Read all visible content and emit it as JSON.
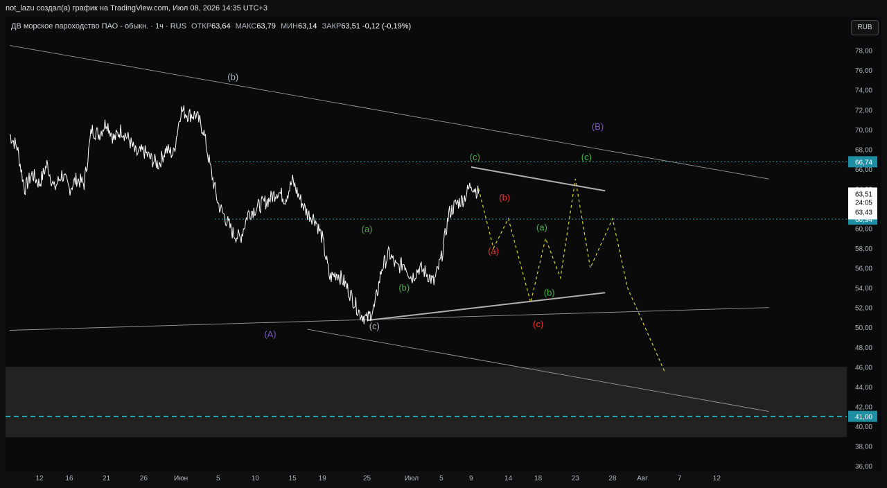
{
  "header": {
    "attribution": "not_lazu создал(а) график на TradingView.com, Июл 08, 2026 14:35 UTC+3"
  },
  "legend": {
    "symbol": "ДВ морское пароходство ПАО - обыкн.",
    "interval": "1ч",
    "exchange": "RUS",
    "open_label": "ОТКР",
    "open": "63,64",
    "high_label": "МАКС",
    "high": "63,79",
    "low_label": "МИН",
    "low": "63,14",
    "close_label": "ЗАКР",
    "close": "63,51",
    "change": "-0,12 (-0,19%)"
  },
  "currency_button": "RUB",
  "colors": {
    "background": "#0a0a0a",
    "price": "#ffffff",
    "trend": "#9a9a9a",
    "forecast": "#d4d43a",
    "level_cyan": "#26c6da",
    "wave_green": "#4caf50",
    "wave_red": "#e53935",
    "wave_purple": "#7e57c2",
    "wave_gray": "#b2b5be"
  },
  "chart_data": {
    "type": "line",
    "title": "",
    "xlabel": "",
    "ylabel": "",
    "ylim": [
      36,
      80
    ],
    "y_ticks": [
      "78,00",
      "76,00",
      "74,00",
      "72,00",
      "70,00",
      "68,00",
      "66,00",
      "64,00",
      "62,00",
      "60,00",
      "58,00",
      "56,00",
      "54,00",
      "52,00",
      "50,00",
      "48,00",
      "46,00",
      "44,00",
      "42,00",
      "40,00",
      "38,00",
      "36,00"
    ],
    "x_ticks": [
      {
        "label": "12",
        "day": 12
      },
      {
        "label": "16",
        "day": 16
      },
      {
        "label": "21",
        "day": 21
      },
      {
        "label": "26",
        "day": 26
      },
      {
        "label": "Июн",
        "day": 31
      },
      {
        "label": "5",
        "day": 36
      },
      {
        "label": "10",
        "day": 41
      },
      {
        "label": "15",
        "day": 46
      },
      {
        "label": "19",
        "day": 50
      },
      {
        "label": "25",
        "day": 56
      },
      {
        "label": "Июл",
        "day": 62
      },
      {
        "label": "5",
        "day": 66
      },
      {
        "label": "9",
        "day": 70
      },
      {
        "label": "14",
        "day": 75
      },
      {
        "label": "18",
        "day": 79
      },
      {
        "label": "23",
        "day": 84
      },
      {
        "label": "28",
        "day": 89
      },
      {
        "label": "Авг",
        "day": 93
      },
      {
        "label": "7",
        "day": 98
      },
      {
        "label": "12",
        "day": 103
      }
    ],
    "price_series": {
      "name": "",
      "points": [
        [
          8,
          69.5
        ],
        [
          9,
          68.2
        ],
        [
          10,
          64.0
        ],
        [
          11,
          65.5
        ],
        [
          12,
          64.5
        ],
        [
          13,
          66.5
        ],
        [
          14,
          64.0
        ],
        [
          15,
          65.5
        ],
        [
          16,
          64.0
        ],
        [
          17,
          65.0
        ],
        [
          18,
          64.5
        ],
        [
          19,
          70.0
        ],
        [
          20,
          69.5
        ],
        [
          21,
          70.8
        ],
        [
          22,
          69.0
        ],
        [
          23,
          70.0
        ],
        [
          24,
          69.0
        ],
        [
          25,
          67.5
        ],
        [
          26,
          67.8
        ],
        [
          27,
          67.0
        ],
        [
          28,
          66.5
        ],
        [
          29,
          68.0
        ],
        [
          30,
          67.5
        ],
        [
          31,
          72.0
        ],
        [
          32,
          71.5
        ],
        [
          33,
          71.5
        ],
        [
          34,
          70.0
        ],
        [
          35,
          66.0
        ],
        [
          36,
          62.5
        ],
        [
          37,
          61.0
        ],
        [
          38,
          59.5
        ],
        [
          39,
          59.0
        ],
        [
          40,
          61.5
        ],
        [
          41,
          62.0
        ],
        [
          42,
          62.5
        ],
        [
          43,
          63.0
        ],
        [
          44,
          63.8
        ],
        [
          45,
          63.0
        ],
        [
          46,
          64.8
        ],
        [
          47,
          63.0
        ],
        [
          48,
          61.5
        ],
        [
          49,
          61.0
        ],
        [
          50,
          59.0
        ],
        [
          51,
          55.0
        ],
        [
          52,
          55.5
        ],
        [
          53,
          54.5
        ],
        [
          54,
          53.0
        ],
        [
          55,
          51.5
        ],
        [
          56,
          50.8
        ],
        [
          57,
          52.0
        ],
        [
          58,
          56.0
        ],
        [
          59,
          57.5
        ],
        [
          60,
          56.0
        ],
        [
          61,
          56.5
        ],
        [
          62,
          55.0
        ],
        [
          63,
          56.0
        ],
        [
          64,
          55.5
        ],
        [
          65,
          54.5
        ],
        [
          66,
          57.0
        ],
        [
          67,
          61.5
        ],
        [
          68,
          62.5
        ],
        [
          69,
          63.0
        ],
        [
          70,
          64.5
        ],
        [
          71,
          63.51
        ]
      ]
    },
    "forecast_path": {
      "name": "",
      "points": [
        [
          71,
          64.0
        ],
        [
          73,
          58.0
        ],
        [
          75,
          61.0
        ],
        [
          78,
          52.5
        ],
        [
          80,
          59.0
        ],
        [
          82,
          55.0
        ],
        [
          84,
          65.0
        ],
        [
          86,
          56.0
        ],
        [
          89,
          61.0
        ],
        [
          91,
          54.0
        ],
        [
          96,
          45.5
        ]
      ]
    },
    "trendlines": [
      {
        "from": [
          8,
          78.5
        ],
        "to": [
          110,
          65.0
        ],
        "weight": 1
      },
      {
        "from": [
          8,
          49.7
        ],
        "to": [
          110,
          52.0
        ],
        "weight": 1
      },
      {
        "from": [
          48,
          49.8
        ],
        "to": [
          110,
          41.5
        ],
        "weight": 1
      },
      {
        "from": [
          70,
          66.2
        ],
        "to": [
          88,
          63.8
        ],
        "weight": 2
      },
      {
        "from": [
          56,
          50.7
        ],
        "to": [
          88,
          53.5
        ],
        "weight": 2
      }
    ],
    "horizontal_levels": [
      {
        "value": 66.74,
        "label": "66,74",
        "style": "dotted"
      },
      {
        "value": 60.94,
        "label": "60,94",
        "style": "dotted"
      },
      {
        "value": 41.0,
        "label": "41,00",
        "style": "dashed"
      }
    ],
    "zone": {
      "from": 38.9,
      "to": 46.0
    },
    "price_labels": {
      "last": "63,51",
      "countdown": "24:05",
      "prev": "63,43",
      "last_value": 63.51
    },
    "annotations": [
      {
        "text": "(b)",
        "x": 38,
        "y": 75.0,
        "color": "wave_gray"
      },
      {
        "text": "(B)",
        "x": 87,
        "y": 70.0,
        "color": "wave_purple"
      },
      {
        "text": "(A)",
        "x": 43,
        "y": 49.0,
        "color": "wave_purple"
      },
      {
        "text": "(c)",
        "x": 57,
        "y": 49.8,
        "color": "wave_gray"
      },
      {
        "text": "(a)",
        "x": 56,
        "y": 59.6,
        "color": "wave_green"
      },
      {
        "text": "(b)",
        "x": 61,
        "y": 53.7,
        "color": "wave_green"
      },
      {
        "text": "(c)",
        "x": 70.5,
        "y": 66.9,
        "color": "wave_green"
      },
      {
        "text": "(b)",
        "x": 74.5,
        "y": 62.8,
        "color": "wave_red"
      },
      {
        "text": "(a)",
        "x": 73,
        "y": 57.4,
        "color": "wave_red"
      },
      {
        "text": "(c)",
        "x": 79,
        "y": 50.0,
        "color": "wave_red"
      },
      {
        "text": "(a)",
        "x": 79.5,
        "y": 59.8,
        "color": "wave_green"
      },
      {
        "text": "(b)",
        "x": 80.5,
        "y": 53.2,
        "color": "wave_green"
      },
      {
        "text": "(c)",
        "x": 85.5,
        "y": 66.9,
        "color": "wave_green"
      }
    ]
  }
}
